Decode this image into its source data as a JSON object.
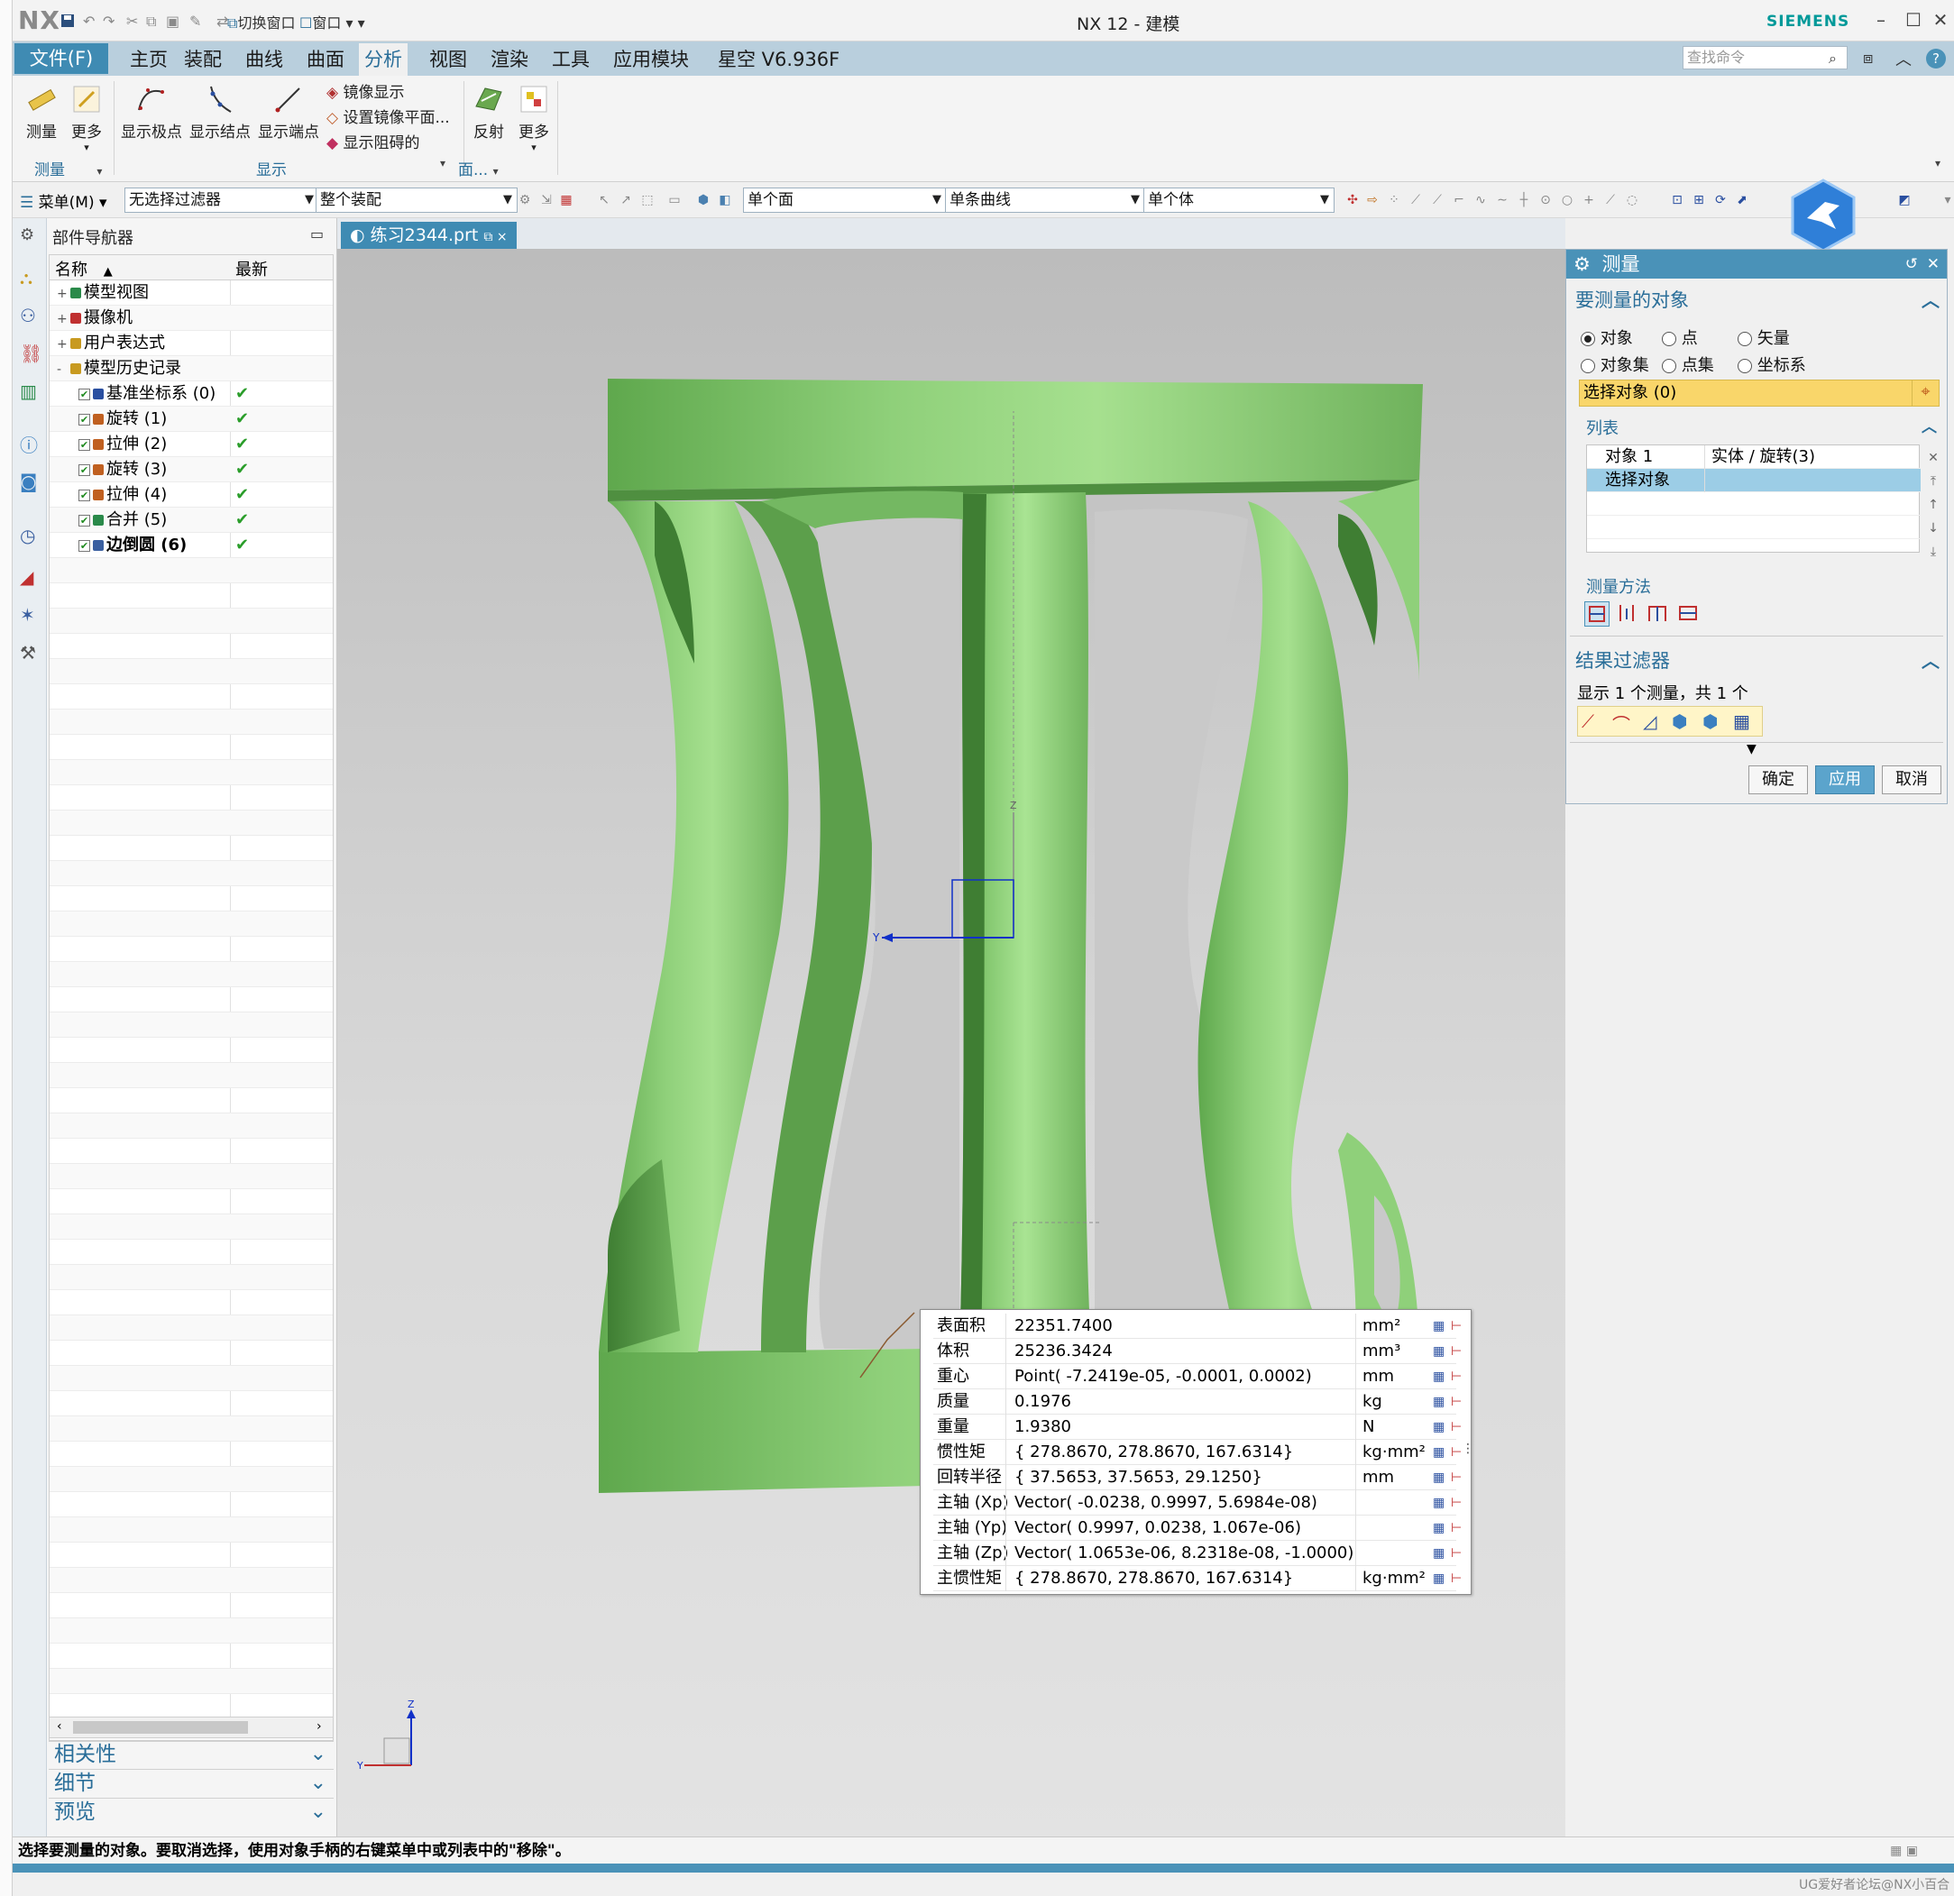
{
  "titlebar": {
    "logo": "NX",
    "switch_window": "切换窗口",
    "window": "窗口",
    "title": "NX 12 - 建模",
    "brand": "SIEMENS"
  },
  "menubar": {
    "file": "文件(F)",
    "tabs": [
      "主页",
      "装配",
      "曲线",
      "曲面",
      "分析",
      "视图",
      "渲染",
      "工具",
      "应用模块",
      "星空 V6.936F"
    ],
    "active_tab": "分析",
    "search_placeholder": "查找命令"
  },
  "ribbon": {
    "measure": "测量",
    "more": "更多",
    "show_poles": "显示极点",
    "show_knots": "显示结点",
    "show_endpoints": "显示端点",
    "mirror_display": "镜像显示",
    "set_mirror_plane": "设置镜像平面...",
    "show_blocked": "显示阻碍的",
    "reflection": "反射",
    "more2": "更多",
    "group_measure": "测量",
    "group_display": "显示",
    "group_face": "面..."
  },
  "selection_toolbar": {
    "menu": "菜单(M)",
    "filter": "无选择过滤器",
    "scope": "整个装配",
    "face_rule": "单个面",
    "curve_rule": "单条曲线",
    "body_rule": "单个体"
  },
  "navigator": {
    "title": "部件导航器",
    "col_name": "名称",
    "col_latest": "最新",
    "items": [
      {
        "toggle": "+",
        "label": "模型视图",
        "latest": "",
        "checked": false
      },
      {
        "toggle": "+",
        "label": "摄像机",
        "latest": "",
        "checked": false
      },
      {
        "toggle": "+",
        "label": "用户表达式",
        "latest": "",
        "checked": false
      },
      {
        "toggle": "-",
        "label": "模型历史记录",
        "latest": "",
        "checked": false
      },
      {
        "toggle": "",
        "label": "基准坐标系 (0)",
        "latest": "✔",
        "checked": true
      },
      {
        "toggle": "",
        "label": "旋转 (1)",
        "latest": "✔",
        "checked": true
      },
      {
        "toggle": "",
        "label": "拉伸 (2)",
        "latest": "✔",
        "checked": true
      },
      {
        "toggle": "",
        "label": "旋转 (3)",
        "latest": "✔",
        "checked": true
      },
      {
        "toggle": "",
        "label": "拉伸 (4)",
        "latest": "✔",
        "checked": true
      },
      {
        "toggle": "",
        "label": "合并 (5)",
        "latest": "✔",
        "checked": true
      },
      {
        "toggle": "",
        "label": "边倒圆 (6)",
        "latest": "✔",
        "checked": true
      }
    ],
    "panels": [
      "相关性",
      "细节",
      "预览"
    ]
  },
  "document_tab": "练习2344.prt",
  "viewport": {
    "model_color": "#7dc46a",
    "triad_labels": {
      "z": "Z",
      "y": "Y"
    }
  },
  "mass_properties": [
    {
      "name": "表面积",
      "value": "22351.7400",
      "unit": "mm²"
    },
    {
      "name": "体积",
      "value": "25236.3424",
      "unit": "mm³"
    },
    {
      "name": "重心",
      "value": "Point( -7.2419e-05, -0.0001, 0.0002)",
      "unit": "mm"
    },
    {
      "name": "质量",
      "value": "0.1976",
      "unit": "kg"
    },
    {
      "name": "重量",
      "value": "1.9380",
      "unit": "N"
    },
    {
      "name": "惯性矩",
      "value": "{ 278.8670, 278.8670, 167.6314}",
      "unit": "kg·mm²"
    },
    {
      "name": "回转半径",
      "value": "{ 37.5653, 37.5653, 29.1250}",
      "unit": "mm"
    },
    {
      "name": "主轴 (Xp)",
      "value": "Vector( -0.0238, 0.9997, 5.6984e-08)",
      "unit": ""
    },
    {
      "name": "主轴 (Yp)",
      "value": "Vector( 0.9997, 0.0238, 1.067e-06)",
      "unit": ""
    },
    {
      "name": "主轴 (Zp)",
      "value": "Vector( 1.0653e-06, 8.2318e-08, -1.0000)",
      "unit": ""
    },
    {
      "name": "主惯性矩",
      "value": "{ 278.8670, 278.8670, 167.6314}",
      "unit": "kg·mm²"
    }
  ],
  "dialog": {
    "title": "测量",
    "section_objects": "要测量的对象",
    "radios": [
      {
        "label": "对象",
        "on": true
      },
      {
        "label": "点",
        "on": false
      },
      {
        "label": "矢量",
        "on": false
      },
      {
        "label": "对象集",
        "on": false
      },
      {
        "label": "点集",
        "on": false
      },
      {
        "label": "坐标系",
        "on": false
      }
    ],
    "select_object": "选择对象 (0)",
    "list_title": "列表",
    "list_rows": [
      {
        "col1": "对象 1",
        "col2": "实体 / 旋转(3)"
      },
      {
        "col1": "选择对象",
        "col2": ""
      }
    ],
    "measure_method": "测量方法",
    "result_filter": "结果过滤器",
    "result_summary": "显示 1 个测量，共 1 个",
    "ok": "确定",
    "apply": "应用",
    "cancel": "取消"
  },
  "status": {
    "message": "选择要测量的对象。要取消选择，使用对象手柄的右键菜单中或列表中的\"移除\"。"
  },
  "watermark": "UG爱好者论坛@NX小百合",
  "colors": {
    "accent": "#3f8bb3",
    "menubar": "#b9cfdd",
    "highlight": "#f9d66a",
    "check_green": "#2a9d2a"
  }
}
